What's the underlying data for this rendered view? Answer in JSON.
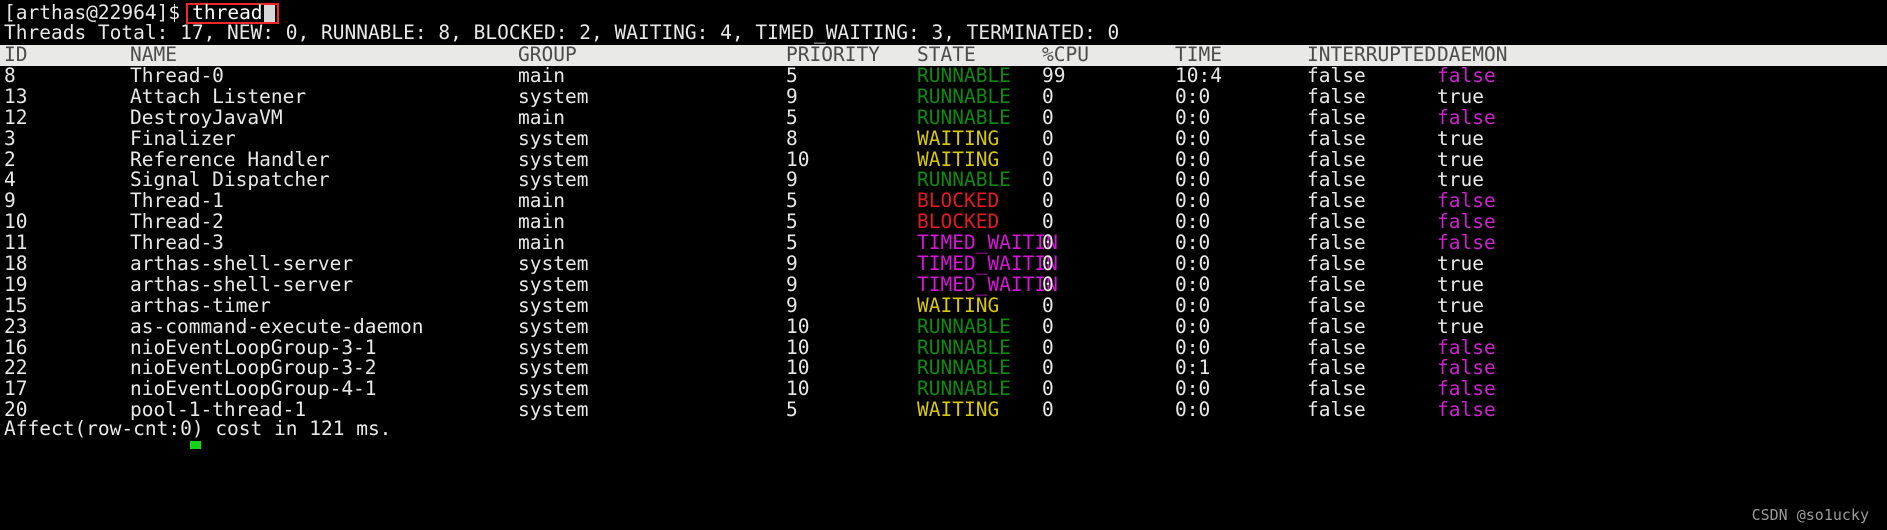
{
  "terminal": {
    "prompt": "[arthas@22964]$",
    "command": "thread",
    "summary": "Threads Total: 17, NEW: 0, RUNNABLE: 8, BLOCKED: 2, WAITING: 4, TIMED_WAITING: 3, TERMINATED: 0",
    "affect": "Affect(row-cnt:0) cost in 121 ms.",
    "watermark": "CSDN @so1ucky"
  },
  "colors": {
    "background": "#000000",
    "foreground": "#e8e8e8",
    "header_bg": "#e9e9e7",
    "header_fg": "#4b4b4b",
    "runnable": "#0c8a10",
    "waiting": "#d8c800",
    "blocked": "#e01b24",
    "timed_waiting": "#d616d6",
    "daemon_false": "#cc23cc",
    "command_box_border": "#f0262c",
    "cursor": "#17d317"
  },
  "table": {
    "columns": [
      "ID",
      "NAME",
      "GROUP",
      "PRIORITY",
      "STATE",
      "%CPU",
      "TIME",
      "INTERRUPTED",
      "DAEMON"
    ],
    "rows": [
      {
        "id": "8",
        "name": "Thread-0",
        "group": "main",
        "priority": "5",
        "state": "RUNNABLE",
        "state_key": "RUNNABLE",
        "cpu": "99",
        "time": "10:4",
        "interrupted": "false",
        "daemon": "false"
      },
      {
        "id": "13",
        "name": "Attach Listener",
        "group": "system",
        "priority": "9",
        "state": "RUNNABLE",
        "state_key": "RUNNABLE",
        "cpu": "0",
        "time": "0:0",
        "interrupted": "false",
        "daemon": "true"
      },
      {
        "id": "12",
        "name": "DestroyJavaVM",
        "group": "main",
        "priority": "5",
        "state": "RUNNABLE",
        "state_key": "RUNNABLE",
        "cpu": "0",
        "time": "0:0",
        "interrupted": "false",
        "daemon": "false"
      },
      {
        "id": "3",
        "name": "Finalizer",
        "group": "system",
        "priority": "8",
        "state": "WAITING",
        "state_key": "WAITING",
        "cpu": "0",
        "time": "0:0",
        "interrupted": "false",
        "daemon": "true"
      },
      {
        "id": "2",
        "name": "Reference Handler",
        "group": "system",
        "priority": "10",
        "state": "WAITING",
        "state_key": "WAITING",
        "cpu": "0",
        "time": "0:0",
        "interrupted": "false",
        "daemon": "true"
      },
      {
        "id": "4",
        "name": "Signal Dispatcher",
        "group": "system",
        "priority": "9",
        "state": "RUNNABLE",
        "state_key": "RUNNABLE",
        "cpu": "0",
        "time": "0:0",
        "interrupted": "false",
        "daemon": "true"
      },
      {
        "id": "9",
        "name": "Thread-1",
        "group": "main",
        "priority": "5",
        "state": "BLOCKED",
        "state_key": "BLOCKED",
        "cpu": "0",
        "time": "0:0",
        "interrupted": "false",
        "daemon": "false"
      },
      {
        "id": "10",
        "name": "Thread-2",
        "group": "main",
        "priority": "5",
        "state": "BLOCKED",
        "state_key": "BLOCKED",
        "cpu": "0",
        "time": "0:0",
        "interrupted": "false",
        "daemon": "false"
      },
      {
        "id": "11",
        "name": "Thread-3",
        "group": "main",
        "priority": "5",
        "state": "TIMED_WAITIN",
        "state_key": "TIMED_WAITING",
        "cpu": "0",
        "time": "0:0",
        "interrupted": "false",
        "daemon": "false"
      },
      {
        "id": "18",
        "name": "arthas-shell-server",
        "group": "system",
        "priority": "9",
        "state": "TIMED_WAITIN",
        "state_key": "TIMED_WAITING",
        "cpu": "0",
        "time": "0:0",
        "interrupted": "false",
        "daemon": "true"
      },
      {
        "id": "19",
        "name": "arthas-shell-server",
        "group": "system",
        "priority": "9",
        "state": "TIMED_WAITIN",
        "state_key": "TIMED_WAITING",
        "cpu": "0",
        "time": "0:0",
        "interrupted": "false",
        "daemon": "true"
      },
      {
        "id": "15",
        "name": "arthas-timer",
        "group": "system",
        "priority": "9",
        "state": "WAITING",
        "state_key": "WAITING",
        "cpu": "0",
        "time": "0:0",
        "interrupted": "false",
        "daemon": "true"
      },
      {
        "id": "23",
        "name": "as-command-execute-daemon",
        "group": "system",
        "priority": "10",
        "state": "RUNNABLE",
        "state_key": "RUNNABLE",
        "cpu": "0",
        "time": "0:0",
        "interrupted": "false",
        "daemon": "true"
      },
      {
        "id": "16",
        "name": "nioEventLoopGroup-3-1",
        "group": "system",
        "priority": "10",
        "state": "RUNNABLE",
        "state_key": "RUNNABLE",
        "cpu": "0",
        "time": "0:0",
        "interrupted": "false",
        "daemon": "false"
      },
      {
        "id": "22",
        "name": "nioEventLoopGroup-3-2",
        "group": "system",
        "priority": "10",
        "state": "RUNNABLE",
        "state_key": "RUNNABLE",
        "cpu": "0",
        "time": "0:1",
        "interrupted": "false",
        "daemon": "false"
      },
      {
        "id": "17",
        "name": "nioEventLoopGroup-4-1",
        "group": "system",
        "priority": "10",
        "state": "RUNNABLE",
        "state_key": "RUNNABLE",
        "cpu": "0",
        "time": "0:0",
        "interrupted": "false",
        "daemon": "false"
      },
      {
        "id": "20",
        "name": "pool-1-thread-1",
        "group": "system",
        "priority": "5",
        "state": "WAITING",
        "state_key": "WAITING",
        "cpu": "0",
        "time": "0:0",
        "interrupted": "false",
        "daemon": "false"
      }
    ]
  }
}
